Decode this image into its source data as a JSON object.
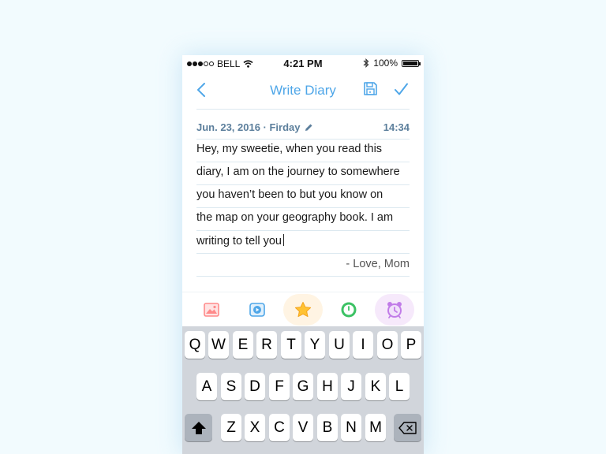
{
  "status_bar": {
    "carrier": "BELL",
    "time": "4:21 PM",
    "battery": "100%",
    "signal_bars": 3,
    "signal_total": 5
  },
  "nav": {
    "title": "Write Diary",
    "back_icon": "chevron-left-icon",
    "save_icon": "floppy-disk-icon",
    "done_icon": "checkmark-icon"
  },
  "entry": {
    "date": "Jun. 23, 2016 · Firday",
    "time": "14:34",
    "lines": [
      "Hey, my sweetie, when you read this",
      "diary, I am on the journey to somewhere",
      "you haven’t been to but you know on",
      "the map on your geography book.  I am",
      "writing to tell you"
    ],
    "signature": "- Love, Mom"
  },
  "toolbar": {
    "tools": [
      {
        "name": "image-tool",
        "icon": "image-icon",
        "color": "#ff8a8a",
        "selected": false
      },
      {
        "name": "video-tool",
        "icon": "play-icon",
        "color": "#4ea6e8",
        "selected": false
      },
      {
        "name": "mood-tool",
        "icon": "star-icon",
        "color": "#ffc233",
        "selected": true
      },
      {
        "name": "time-tool",
        "icon": "clock-icon",
        "color": "#3cc264",
        "selected": false
      },
      {
        "name": "alarm-tool",
        "icon": "alarm-icon",
        "color": "#c17ce8",
        "selected": true
      }
    ]
  },
  "keyboard": {
    "row1": [
      "Q",
      "W",
      "E",
      "R",
      "T",
      "Y",
      "U",
      "I",
      "O",
      "P"
    ],
    "row2": [
      "A",
      "S",
      "D",
      "F",
      "G",
      "H",
      "J",
      "K",
      "L"
    ],
    "row3": [
      "Z",
      "X",
      "C",
      "V",
      "B",
      "N",
      "M"
    ],
    "shift_icon": "shift-arrow-icon",
    "delete_icon": "backspace-icon"
  },
  "colors": {
    "accent": "#4ea6e8",
    "date_text": "#5c7f9c",
    "background": "#f2fbfe"
  }
}
